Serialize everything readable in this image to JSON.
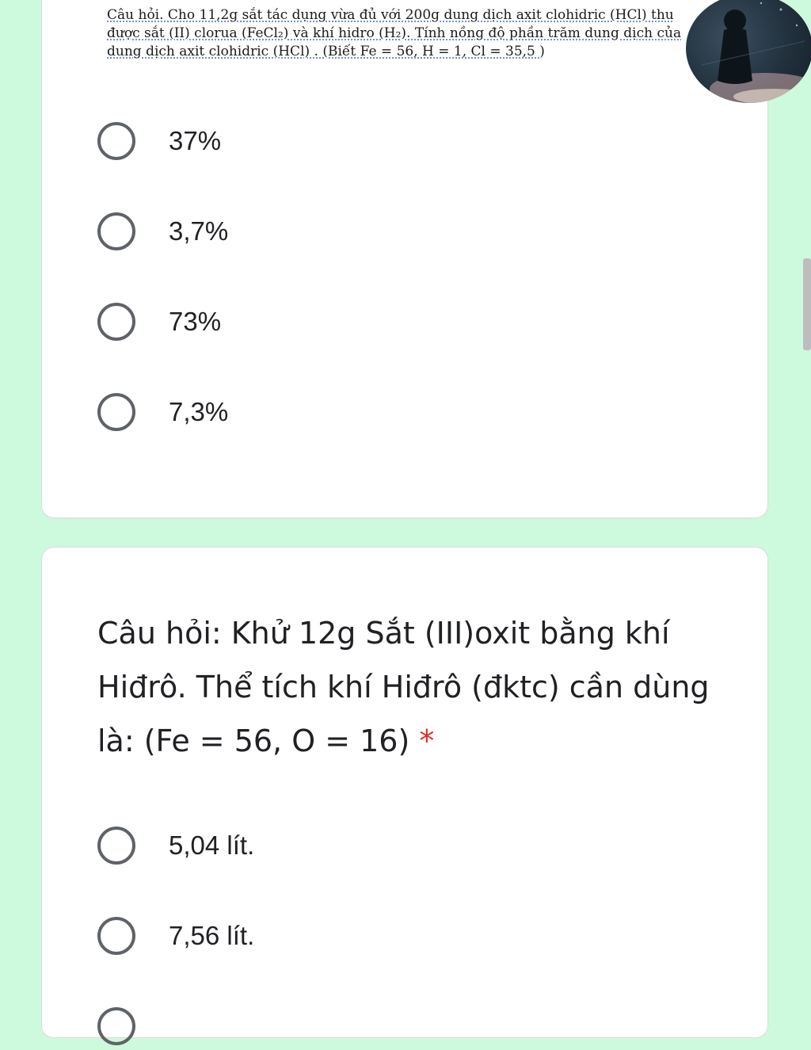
{
  "question1": {
    "image_lines": [
      "Câu hỏi. Cho 11,2g  sắt tác dụng vừa đủ  với 200g dung dịch axit clohidric (HCl) thu",
      "được sắt (II) clorua (FeCl₂) và khí hidro (H₂). Tính nồng độ phần trăm dung dịch của",
      "dung dịch axit clohidric (HCl) . (Biết Fe = 56, H = 1, Cl = 35,5 )"
    ],
    "options": [
      "37%",
      "3,7%",
      "73%",
      "7,3%"
    ]
  },
  "question2": {
    "text": "Câu hỏi: Khử 12g Sắt (III)oxit bằng khí Hiđrô. Thể tích khí Hiđrô (đktc) cần dùng là: (Fe = 56, O = 16)",
    "required_mark": "*",
    "options": [
      "5,04 lít.",
      "7,56 lít."
    ]
  },
  "colors": {
    "background": "#cdf9dc",
    "card": "#ffffff",
    "radio": "#5f6368",
    "required": "#d93025"
  }
}
